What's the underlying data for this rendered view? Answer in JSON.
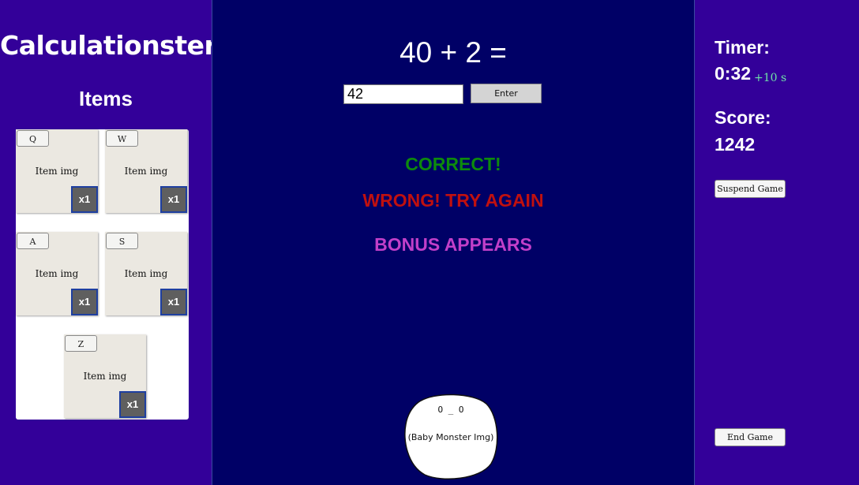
{
  "sidebar": {
    "logo": "Calculationster",
    "items_title": "Items",
    "items": [
      {
        "key": "Q",
        "image_label": "Item img",
        "count": "x1"
      },
      {
        "key": "W",
        "image_label": "Item img",
        "count": "x1"
      },
      {
        "key": "A",
        "image_label": "Item img",
        "count": "x1"
      },
      {
        "key": "S",
        "image_label": "Item img",
        "count": "x1"
      },
      {
        "key": "Z",
        "image_label": "Item img",
        "count": "x1"
      }
    ]
  },
  "game": {
    "question": "40 + 2 =",
    "answer_value": "42",
    "enter_label": "Enter",
    "messages": {
      "correct": "CORRECT!",
      "wrong": "WRONG! TRY AGAIN",
      "bonus": "BONUS APPEARS"
    },
    "monster": {
      "face": "O _ O",
      "label": "(Baby Monster Img)"
    }
  },
  "stats": {
    "timer_label": "Timer:",
    "timer_value": "0:32",
    "timer_bonus": "+10 s",
    "score_label": "Score:",
    "score_value": "1242",
    "suspend_label": "Suspend Game",
    "end_label": "End Game"
  },
  "colors": {
    "side_bg": "#330099",
    "center_bg": "#000066",
    "correct": "#0d8a0d",
    "wrong": "#c0100f",
    "bonus": "#c23fc9",
    "timer_bonus": "#6fe3a8"
  }
}
